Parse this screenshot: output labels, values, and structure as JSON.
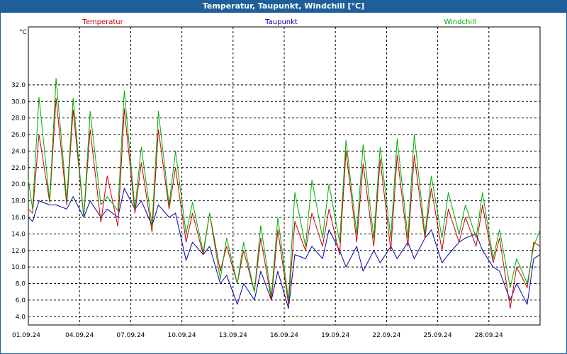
{
  "window": {
    "title": "Temperatur, Taupunkt, Windchill [°C]"
  },
  "chart_data": {
    "type": "line",
    "title": "Temperatur, Taupunkt, Windchill [°C]",
    "ylabel": "°C",
    "xlabel": "",
    "ylim": [
      3.0,
      39.0
    ],
    "yticks": [
      4.0,
      6.0,
      8.0,
      10.0,
      12.0,
      14.0,
      16.0,
      18.0,
      20.0,
      22.0,
      24.0,
      26.0,
      28.0,
      30.0,
      32.0
    ],
    "xlim": [
      "2024-09-01",
      "2024-10-01"
    ],
    "xtick_labels": [
      "01.09.24",
      "04.09.24",
      "07.09.24",
      "10.09.24",
      "13.09.24",
      "16.09.24",
      "19.09.24",
      "22.09.24",
      "25.09.24",
      "28.09.24"
    ],
    "grid": true,
    "legend_position": "top",
    "colors": {
      "Temperatur": "#cc0000",
      "Taupunkt": "#0000aa",
      "Windchill": "#00aa00"
    },
    "series": [
      {
        "name": "Temperatur",
        "values": [
          [
            "2024-09-01 00:00",
            17.0
          ],
          [
            "2024-09-01 06:00",
            16.5
          ],
          [
            "2024-09-01 15:00",
            26.0
          ],
          [
            "2024-09-02 06:00",
            17.8
          ],
          [
            "2024-09-02 15:00",
            30.4
          ],
          [
            "2024-09-03 06:00",
            17.5
          ],
          [
            "2024-09-03 15:00",
            29.0
          ],
          [
            "2024-09-04 06:00",
            16.0
          ],
          [
            "2024-09-04 15:00",
            26.6
          ],
          [
            "2024-09-05 06:00",
            15.4
          ],
          [
            "2024-09-05 15:00",
            21.0
          ],
          [
            "2024-09-06 06:00",
            14.9
          ],
          [
            "2024-09-06 15:00",
            29.1
          ],
          [
            "2024-09-07 06:00",
            16.5
          ],
          [
            "2024-09-07 15:00",
            22.6
          ],
          [
            "2024-09-08 06:00",
            14.2
          ],
          [
            "2024-09-08 15:00",
            26.6
          ],
          [
            "2024-09-09 06:00",
            17.0
          ],
          [
            "2024-09-09 15:00",
            22.0
          ],
          [
            "2024-09-10 06:00",
            13.0
          ],
          [
            "2024-09-10 15:00",
            16.5
          ],
          [
            "2024-09-11 06:00",
            11.5
          ],
          [
            "2024-09-11 15:00",
            16.5
          ],
          [
            "2024-09-12 06:00",
            9.5
          ],
          [
            "2024-09-12 15:00",
            12.5
          ],
          [
            "2024-09-13 06:00",
            8.0
          ],
          [
            "2024-09-13 15:00",
            12.0
          ],
          [
            "2024-09-14 06:00",
            7.0
          ],
          [
            "2024-09-14 15:00",
            13.5
          ],
          [
            "2024-09-15 06:00",
            6.0
          ],
          [
            "2024-09-15 15:00",
            14.5
          ],
          [
            "2024-09-16 06:00",
            5.5
          ],
          [
            "2024-09-16 15:00",
            15.5
          ],
          [
            "2024-09-17 06:00",
            12.0
          ],
          [
            "2024-09-17 15:00",
            16.5
          ],
          [
            "2024-09-18 06:00",
            12.5
          ],
          [
            "2024-09-18 15:00",
            17.0
          ],
          [
            "2024-09-19 06:00",
            11.5
          ],
          [
            "2024-09-19 15:00",
            24.0
          ],
          [
            "2024-09-20 06:00",
            13.0
          ],
          [
            "2024-09-20 15:00",
            22.5
          ],
          [
            "2024-09-21 06:00",
            12.5
          ],
          [
            "2024-09-21 15:00",
            23.0
          ],
          [
            "2024-09-22 06:00",
            12.0
          ],
          [
            "2024-09-22 15:00",
            23.5
          ],
          [
            "2024-09-23 06:00",
            12.5
          ],
          [
            "2024-09-23 15:00",
            23.5
          ],
          [
            "2024-09-24 06:00",
            13.5
          ],
          [
            "2024-09-24 15:00",
            19.5
          ],
          [
            "2024-09-25 06:00",
            12.0
          ],
          [
            "2024-09-25 15:00",
            17.0
          ],
          [
            "2024-09-26 06:00",
            13.0
          ],
          [
            "2024-09-26 15:00",
            16.0
          ],
          [
            "2024-09-27 06:00",
            12.5
          ],
          [
            "2024-09-27 15:00",
            17.5
          ],
          [
            "2024-09-28 06:00",
            10.5
          ],
          [
            "2024-09-28 15:00",
            13.5
          ],
          [
            "2024-09-29 06:00",
            5.0
          ],
          [
            "2024-09-29 15:00",
            10.0
          ],
          [
            "2024-09-30 06:00",
            7.5
          ],
          [
            "2024-09-30 15:00",
            13.0
          ],
          [
            "2024-10-01 00:00",
            12.5
          ]
        ]
      },
      {
        "name": "Taupunkt",
        "values": [
          [
            "2024-09-01 00:00",
            16.0
          ],
          [
            "2024-09-01 06:00",
            15.5
          ],
          [
            "2024-09-01 15:00",
            18.0
          ],
          [
            "2024-09-02 06:00",
            17.5
          ],
          [
            "2024-09-02 15:00",
            17.5
          ],
          [
            "2024-09-03 06:00",
            17.0
          ],
          [
            "2024-09-03 15:00",
            18.5
          ],
          [
            "2024-09-04 06:00",
            16.0
          ],
          [
            "2024-09-04 15:00",
            18.0
          ],
          [
            "2024-09-05 06:00",
            16.0
          ],
          [
            "2024-09-05 15:00",
            17.0
          ],
          [
            "2024-09-06 06:00",
            16.0
          ],
          [
            "2024-09-06 15:00",
            19.5
          ],
          [
            "2024-09-07 06:00",
            17.0
          ],
          [
            "2024-09-07 15:00",
            18.0
          ],
          [
            "2024-09-08 06:00",
            15.0
          ],
          [
            "2024-09-08 15:00",
            17.5
          ],
          [
            "2024-09-09 06:00",
            16.0
          ],
          [
            "2024-09-09 15:00",
            16.5
          ],
          [
            "2024-09-10 06:00",
            10.8
          ],
          [
            "2024-09-10 15:00",
            13.0
          ],
          [
            "2024-09-11 06:00",
            11.5
          ],
          [
            "2024-09-11 15:00",
            12.5
          ],
          [
            "2024-09-12 06:00",
            8.0
          ],
          [
            "2024-09-12 15:00",
            9.0
          ],
          [
            "2024-09-13 06:00",
            5.5
          ],
          [
            "2024-09-13 15:00",
            8.0
          ],
          [
            "2024-09-14 06:00",
            6.0
          ],
          [
            "2024-09-14 15:00",
            9.5
          ],
          [
            "2024-09-15 06:00",
            6.0
          ],
          [
            "2024-09-15 15:00",
            9.5
          ],
          [
            "2024-09-16 06:00",
            5.0
          ],
          [
            "2024-09-16 15:00",
            11.5
          ],
          [
            "2024-09-17 06:00",
            11.0
          ],
          [
            "2024-09-17 15:00",
            12.5
          ],
          [
            "2024-09-18 06:00",
            11.0
          ],
          [
            "2024-09-18 15:00",
            14.5
          ],
          [
            "2024-09-19 06:00",
            12.0
          ],
          [
            "2024-09-19 15:00",
            10.0
          ],
          [
            "2024-09-20 06:00",
            12.5
          ],
          [
            "2024-09-20 15:00",
            9.5
          ],
          [
            "2024-09-21 06:00",
            12.0
          ],
          [
            "2024-09-21 15:00",
            10.5
          ],
          [
            "2024-09-22 06:00",
            12.5
          ],
          [
            "2024-09-22 15:00",
            11.0
          ],
          [
            "2024-09-23 06:00",
            13.0
          ],
          [
            "2024-09-23 15:00",
            11.0
          ],
          [
            "2024-09-24 06:00",
            13.5
          ],
          [
            "2024-09-24 15:00",
            14.5
          ],
          [
            "2024-09-25 06:00",
            10.5
          ],
          [
            "2024-09-25 15:00",
            11.5
          ],
          [
            "2024-09-26 06:00",
            13.0
          ],
          [
            "2024-09-26 15:00",
            13.5
          ],
          [
            "2024-09-27 06:00",
            14.0
          ],
          [
            "2024-09-27 15:00",
            12.0
          ],
          [
            "2024-09-28 06:00",
            10.0
          ],
          [
            "2024-09-28 15:00",
            9.5
          ],
          [
            "2024-09-29 06:00",
            6.0
          ],
          [
            "2024-09-29 15:00",
            8.0
          ],
          [
            "2024-09-30 06:00",
            5.5
          ],
          [
            "2024-09-30 15:00",
            11.0
          ],
          [
            "2024-10-01 00:00",
            11.5
          ]
        ]
      },
      {
        "name": "Windchill",
        "values": [
          [
            "2024-09-01 00:00",
            20.5
          ],
          [
            "2024-09-01 06:00",
            17.0
          ],
          [
            "2024-09-01 15:00",
            30.5
          ],
          [
            "2024-09-02 06:00",
            18.0
          ],
          [
            "2024-09-02 15:00",
            32.8
          ],
          [
            "2024-09-03 06:00",
            18.0
          ],
          [
            "2024-09-03 15:00",
            30.4
          ],
          [
            "2024-09-04 06:00",
            16.0
          ],
          [
            "2024-09-04 15:00",
            28.8
          ],
          [
            "2024-09-05 06:00",
            17.5
          ],
          [
            "2024-09-05 15:00",
            18.5
          ],
          [
            "2024-09-06 06:00",
            16.8
          ],
          [
            "2024-09-06 15:00",
            31.3
          ],
          [
            "2024-09-07 06:00",
            17.0
          ],
          [
            "2024-09-07 15:00",
            24.5
          ],
          [
            "2024-09-08 06:00",
            15.0
          ],
          [
            "2024-09-08 15:00",
            28.8
          ],
          [
            "2024-09-09 06:00",
            17.5
          ],
          [
            "2024-09-09 15:00",
            24.0
          ],
          [
            "2024-09-10 06:00",
            14.0
          ],
          [
            "2024-09-10 15:00",
            17.8
          ],
          [
            "2024-09-11 06:00",
            11.8
          ],
          [
            "2024-09-11 15:00",
            16.5
          ],
          [
            "2024-09-12 06:00",
            8.5
          ],
          [
            "2024-09-12 15:00",
            13.5
          ],
          [
            "2024-09-13 06:00",
            8.0
          ],
          [
            "2024-09-13 15:00",
            13.0
          ],
          [
            "2024-09-14 06:00",
            7.0
          ],
          [
            "2024-09-14 15:00",
            15.0
          ],
          [
            "2024-09-15 06:00",
            6.5
          ],
          [
            "2024-09-15 15:00",
            16.0
          ],
          [
            "2024-09-16 06:00",
            6.0
          ],
          [
            "2024-09-16 15:00",
            19.0
          ],
          [
            "2024-09-17 06:00",
            12.5
          ],
          [
            "2024-09-17 15:00",
            20.5
          ],
          [
            "2024-09-18 06:00",
            13.5
          ],
          [
            "2024-09-18 15:00",
            20.0
          ],
          [
            "2024-09-19 06:00",
            13.0
          ],
          [
            "2024-09-19 15:00",
            25.3
          ],
          [
            "2024-09-20 06:00",
            14.0
          ],
          [
            "2024-09-20 15:00",
            24.8
          ],
          [
            "2024-09-21 06:00",
            13.5
          ],
          [
            "2024-09-21 15:00",
            24.5
          ],
          [
            "2024-09-22 06:00",
            13.5
          ],
          [
            "2024-09-22 15:00",
            25.5
          ],
          [
            "2024-09-23 06:00",
            13.5
          ],
          [
            "2024-09-23 15:00",
            26.0
          ],
          [
            "2024-09-24 06:00",
            14.0
          ],
          [
            "2024-09-24 15:00",
            21.0
          ],
          [
            "2024-09-25 06:00",
            13.5
          ],
          [
            "2024-09-25 15:00",
            19.0
          ],
          [
            "2024-09-26 06:00",
            14.0
          ],
          [
            "2024-09-26 15:00",
            17.5
          ],
          [
            "2024-09-27 06:00",
            13.5
          ],
          [
            "2024-09-27 15:00",
            19.0
          ],
          [
            "2024-09-28 06:00",
            11.0
          ],
          [
            "2024-09-28 15:00",
            14.5
          ],
          [
            "2024-09-29 06:00",
            7.5
          ],
          [
            "2024-09-29 15:00",
            11.0
          ],
          [
            "2024-09-30 06:00",
            8.0
          ],
          [
            "2024-09-30 15:00",
            12.5
          ],
          [
            "2024-10-01 00:00",
            14.5
          ]
        ]
      }
    ]
  }
}
